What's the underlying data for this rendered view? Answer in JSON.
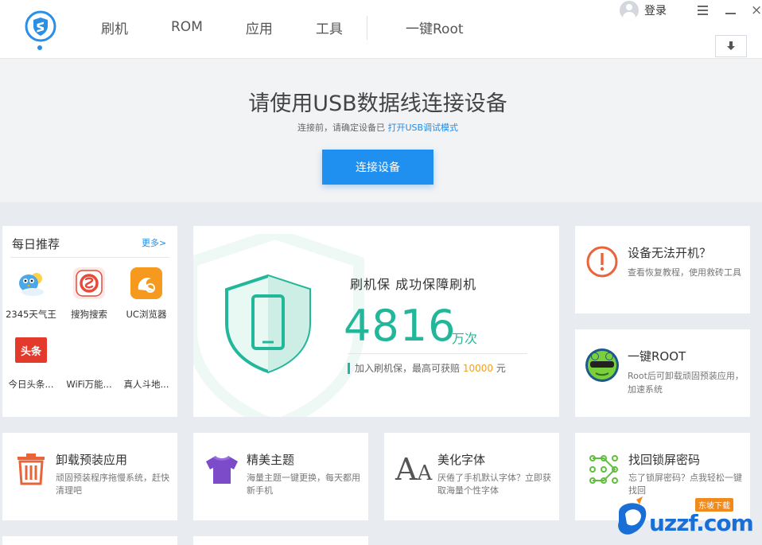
{
  "header": {
    "nav": [
      "刷机",
      "ROM",
      "应用",
      "工具"
    ],
    "root_tab": "一键Root",
    "login": "登录",
    "close_glyph": "×"
  },
  "banner": {
    "title": "请使用USB数据线连接设备",
    "hint_prefix": "连接前，请确定设备已",
    "hint_link": "打开USB调试模式",
    "button": "连接设备"
  },
  "daily": {
    "title": "每日推荐",
    "more": "更多>",
    "apps": [
      {
        "label": "2345天气王",
        "icon": "weather-bird-icon"
      },
      {
        "label": "搜狗搜索",
        "icon": "sogou-icon"
      },
      {
        "label": "UC浏览器",
        "icon": "uc-squirrel-icon"
      },
      {
        "label": "今日头条...",
        "icon": "toutiao-icon",
        "badge": "头条"
      },
      {
        "label": "WiFi万能...",
        "icon": "wifi-icon"
      },
      {
        "label": "真人斗地...",
        "icon": "card-game-icon"
      }
    ]
  },
  "hero": {
    "title": "刷机保   成功保障刷机",
    "count": "4816",
    "unit": "万次",
    "sub_prefix": "加入刷机保，最高可获赔 ",
    "sub_amount": "10000",
    "sub_suffix": " 元"
  },
  "side_cards": [
    {
      "title": "设备无法开机？",
      "desc": "查看恢复教程，使用救砖工具",
      "icon": "exclamation-icon"
    },
    {
      "title": "一键ROOT",
      "desc": "Root后可卸载顽固预装应用，加速系统",
      "icon": "root-frog-icon"
    }
  ],
  "tools": [
    {
      "title": "卸载预装应用",
      "desc": "顽固预装程序拖慢系统，赶快清理吧",
      "icon": "trash-icon"
    },
    {
      "title": "精美主题",
      "desc": "海量主题一键更换，每天都用新手机",
      "icon": "tshirt-icon"
    },
    {
      "title": "美化字体",
      "desc": "厌倦了手机默认字体？立即获取海量个性字体",
      "icon": "font-icon",
      "glyph": "A"
    },
    {
      "title": "找回锁屏密码",
      "desc": "忘了锁屏密码？点我轻松一键找回",
      "icon": "pattern-lock-icon"
    }
  ],
  "watermark": {
    "text": "uzzf.com",
    "tag": "东坡下载"
  },
  "colors": {
    "accent": "#1f8ff0",
    "green": "#22b79a",
    "gold": "#f0a020"
  }
}
